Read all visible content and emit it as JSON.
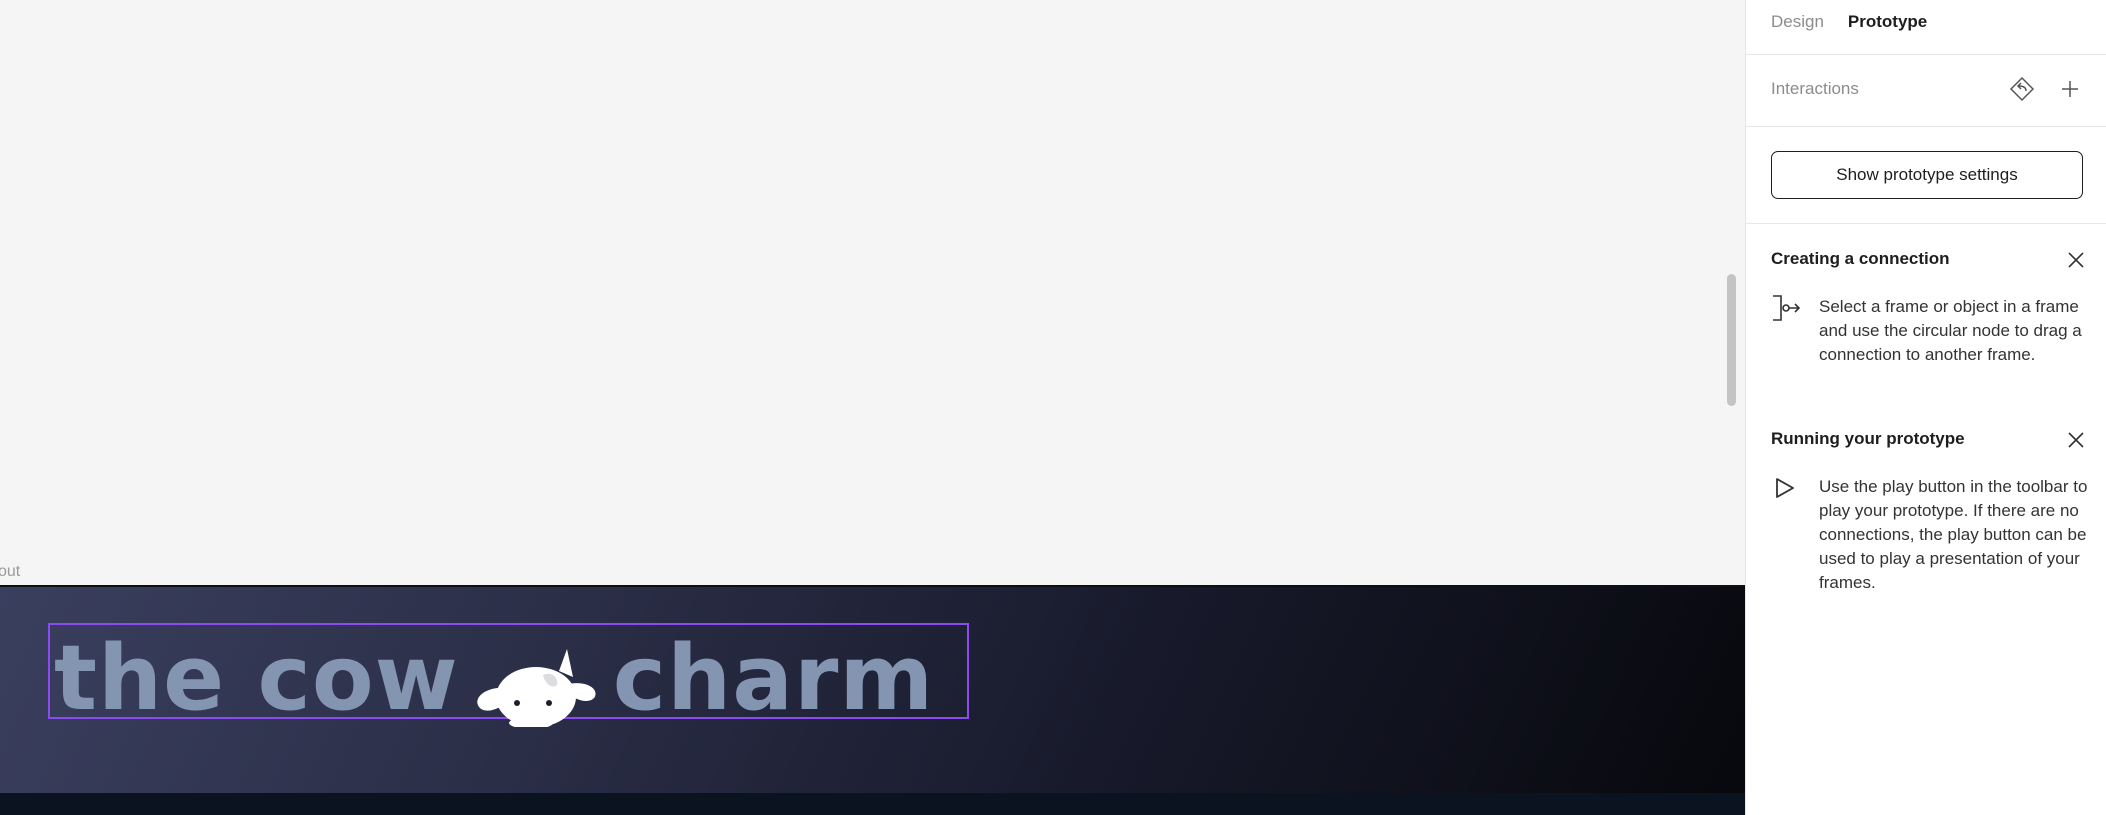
{
  "canvas": {
    "frame_label": "out",
    "hero_text": {
      "part1": "the cow",
      "part2": "charm"
    },
    "colors": {
      "selection": "#8a4bf2",
      "hero_text": "#8495b2"
    }
  },
  "panel": {
    "tabs": [
      {
        "label": "Design",
        "active": false
      },
      {
        "label": "Prototype",
        "active": true
      }
    ],
    "interactions": {
      "title": "Interactions",
      "icons": [
        "reverse-interaction-icon",
        "add-icon"
      ]
    },
    "settings_button": "Show prototype settings",
    "cards": [
      {
        "title": "Creating a connection",
        "icon": "connection-icon",
        "body": "Select a frame or object in a frame and use the circular node to drag a connection to another frame."
      },
      {
        "title": "Running your prototype",
        "icon": "play-icon",
        "body": "Use the play button in the toolbar to play your prototype. If there are no connections, the play button can be used to play a presentation of your frames."
      }
    ]
  }
}
